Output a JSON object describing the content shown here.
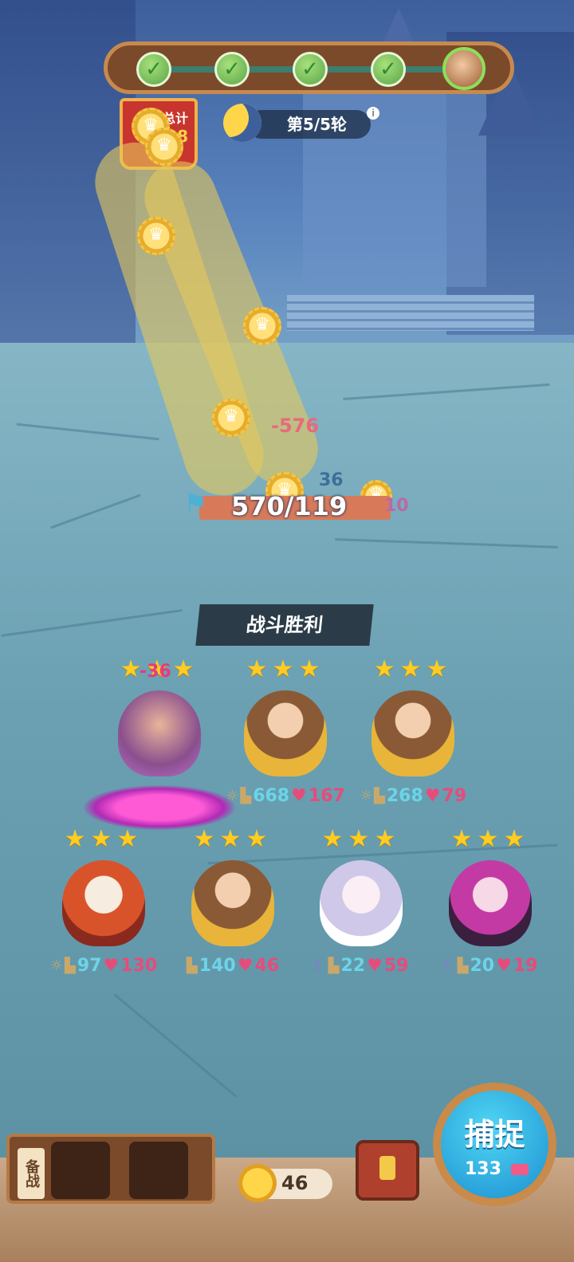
{
  "round_progress": {
    "completed": 4,
    "total": 5,
    "check_symbol": "✓"
  },
  "total_badge": {
    "label": "总计",
    "value": "8"
  },
  "round": {
    "label": "第5/5轮",
    "info_symbol": "i"
  },
  "enemy": {
    "hp_text": "570/119",
    "damage_popup": "-576",
    "atk_value": "36",
    "side_value": "10"
  },
  "battle_result": "战斗胜利",
  "units": [
    {
      "stars": "★★★",
      "atk": "",
      "hp": "",
      "damage_popup": "-36",
      "effect": "portal"
    },
    {
      "stars": "★★★",
      "atk": "668",
      "hp": "167"
    },
    {
      "stars": "★★★",
      "atk": "268",
      "hp": "79"
    },
    {
      "stars": "★★★",
      "atk": "97",
      "hp": "130"
    },
    {
      "stars": "★★★",
      "atk": "140",
      "hp": "46"
    },
    {
      "stars": "★★★",
      "atk": "22",
      "hp": "59"
    },
    {
      "stars": "★★★",
      "atk": "20",
      "hp": "19"
    }
  ],
  "bench": {
    "label": "备战"
  },
  "coins": {
    "value": "46"
  },
  "capture": {
    "label": "捕捉",
    "count": "133"
  },
  "icons": {
    "atk": "boot-icon",
    "hp": "heart-icon",
    "sun": "sun-icon",
    "moon": "moon-icon"
  },
  "colors": {
    "atk": "#6cd4e8",
    "hp": "#e64c7a",
    "star": "#ffcc22",
    "victory_bg": "#2b3c48"
  }
}
